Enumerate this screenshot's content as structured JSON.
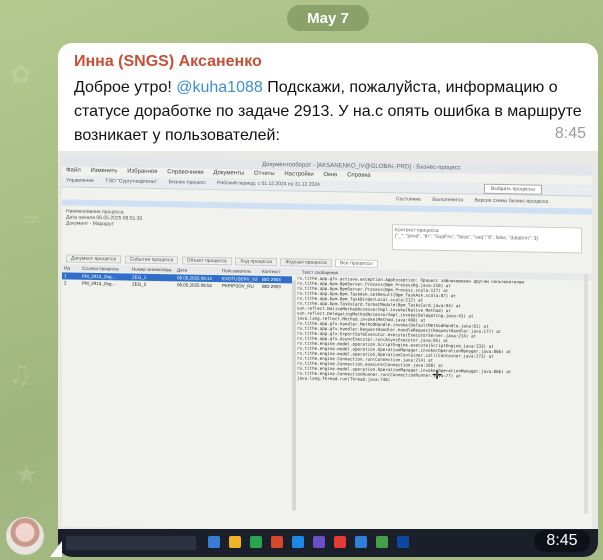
{
  "date_separator": "May 7",
  "message": {
    "sender": "Инна (SNGS) Аксаненко",
    "text_before_mention": "Доброе утро! ",
    "mention": "@kuha1088",
    "text_after_mention": " Подскажи, пожалуйста, информацию о статусе доработке по задаче 2913. У на.с опять ошибка в маршруте возникает у пользователей:",
    "time": "8:45",
    "photo_time": "8:45"
  },
  "photo_screen": {
    "window_title": "Документооборот - [AKSANENKO_IV@GLOBAL-PRD] - Бизнес-процесс",
    "menu": [
      "Файл",
      "Изменить",
      "Избранное",
      "Справочники",
      "Документы",
      "Отчеты",
      "Настройки",
      "Окно",
      "Справка"
    ],
    "toolbar": [
      "Управление",
      "ТЭО \"Сургутнефтегаз\"",
      "Бизнес-процесс",
      "Рабочий период: с 01.12.2024 по 31.12.2024"
    ],
    "execute_label": "Выбрать процессы",
    "row2": [
      "Состояние",
      "Выполняется",
      "Версия схемы бизнес-процесса"
    ],
    "left_panel": [
      "Наименование процесса",
      "Дата начала 06.05.2025 08:51:30",
      "Документ - Маршрут"
    ],
    "context_title": "Контекст процесса",
    "context_text": "{\"_\": \"plmd\", \"th\": \"SupPro\", \"false\", \"seq\":\"8\", false, \"databrm\": 3}",
    "tabs": [
      "Документ процесса",
      "События процесса",
      "Объект процесса",
      "Ход процесса",
      "Журнал процесса",
      "Все процессы"
    ],
    "grid_headers": [
      "Ид",
      "Ссылка процесса",
      "Номер экземпляра",
      "Дата",
      "Пользователь",
      "Контекст",
      "Текст сообщения"
    ],
    "grid_rows": [
      [
        "1",
        "PM_2913_Zeg...",
        "ZEG_1",
        "06.05.2025 06:12",
        "EXOTUSERV_V2",
        "BID 2903"
      ],
      [
        "2",
        "PM_2913_Zeg...",
        "ZEG_2",
        "06.05.2025 06:52",
        "PKPIPSOV_RU",
        "BID 2903"
      ]
    ],
    "log_lines": [
      "ru.tithe.app.gfx.actiave.exception.AppException: Процесс заблокирован другим пользователем",
      "ru.tithe.app.bpm.BpmServer.Process(Bpm_ProcessRg.java:210) at",
      "ru.tithe.app.bpm.BpmServer.Process(Bpm_Process.scala:127) at",
      "ru.tithe.app.bpm.Bpm.TaskAsk.setResult(Bpm_TaskAsk.scala:87) at",
      "ru.tithe.app.bpm.Bpm_TaskBinderLocal.scala:212) at",
      "ru.tithe.app.bpm.TasksCard.formatModule(Bpm_TasksCard.java:94) at",
      "sun.reflect.NativeMethodAccessorImpl.invoke(Native Method) at",
      "sun.reflect.DelegatingMethodAccessorImpl.invoke(Delegating.java:43) at",
      "java.lang.reflect.Method.invoke(Method.java:498) at",
      "ru.tithe.app.gfx.handler.MethodHandle.invoke(DefaultMethodHandle.java:61) at",
      "ru.tithe.app.gfx.handler.RequestHandler.handleRequest(RequestHandler.java:177) at",
      "ru.tithe.app.gfx.ExportSafeExecutor.execute(ExecutorServer.java:214) at",
      "ru.tithe.app.gfx.AsyncExecutor.run(AsyncExecutor.java:95) at",
      "ru.tithe.engine.model.operation.ScriptEngine.execute(ScriptEngine.java:333) at",
      "ru.tithe.engine.model.operation.OperationManager.invoke(OperationManager.java:866) at",
      "ru.tithe.engine.model.operation.OperationContainer.call(Container.java:273) at",
      "ru.tithe.engine.Connection.run(Connection.java:214) at",
      "ru.tithe.engine.Connection.execute(Connection.java:108) at",
      "ru.tithe.engine.model.operation.OperationManager.invoke(OperationManager.java:866) at",
      "ru.tithe.engine.ConnectionRunner.run(ConnectionRunner.java:77) at",
      "java.lang.Thread.run(Thread.java:748)"
    ]
  },
  "colors": {
    "background": "#a9bd86",
    "bubble": "#ffffff",
    "sender": "#c84f36",
    "mention": "#3a8ed6",
    "time": "#9a9a9a",
    "date_pill": "#6e8750"
  }
}
